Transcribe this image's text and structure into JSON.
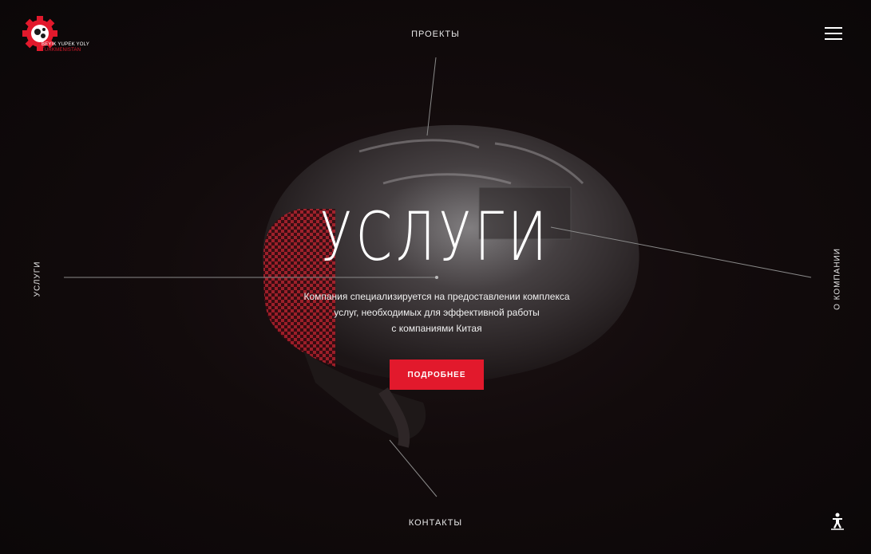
{
  "header": {
    "logo": {
      "line1": "BEYIK YUPEK YOLY",
      "line2": "TURKMENISTAN"
    },
    "nav_top": "ПРОЕКТЫ"
  },
  "nav": {
    "left": "УСЛУГИ",
    "right": "О КОМПАНИИ",
    "bottom": "КОНТАКТЫ"
  },
  "hero": {
    "title": "УСЛУГИ",
    "description_lines": [
      "Компания специализируется на предоставлении комплекса",
      "услуг, необходимых для эффективной работы",
      "с компаниями Китая"
    ],
    "button_label": "ПОДРОБНЕЕ"
  },
  "colors": {
    "accent": "#e2192c",
    "background": "#120b0c"
  },
  "icons": {
    "menu": "hamburger-icon",
    "accessibility": "accessibility-icon"
  }
}
